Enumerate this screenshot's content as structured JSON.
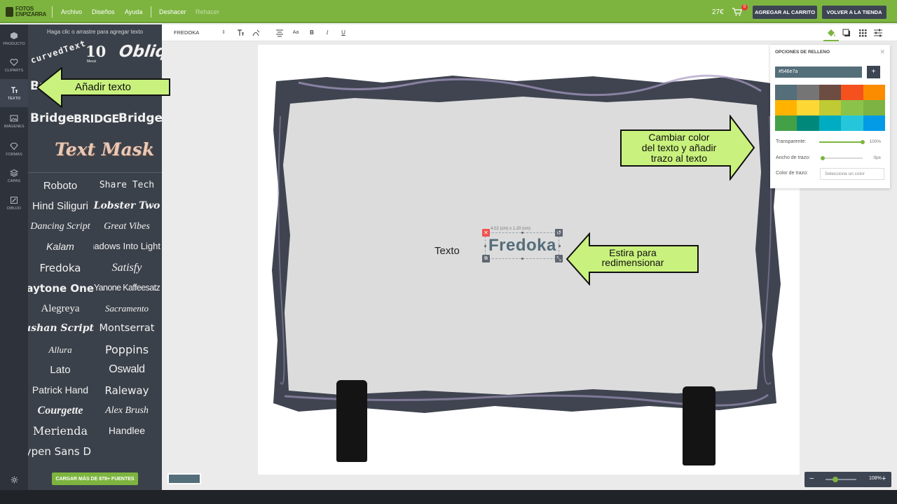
{
  "app": {
    "logo_line1": "FOTOS",
    "logo_line2": "ENPIZARRA"
  },
  "top_menu": {
    "archivo": "Archivo",
    "disenos": "Diseños",
    "ayuda": "Ayuda",
    "deshacer": "Deshacer",
    "rehacer": "Rehacer"
  },
  "header": {
    "price": "27€",
    "cart_count": "0",
    "add_to_cart": "AGREGAR AL CARRITO",
    "back_to_store": "VOLVER A LA TIENDA"
  },
  "rail": {
    "items": [
      {
        "label": "PRODUCTO",
        "icon": "cube-icon"
      },
      {
        "label": "CLIPARTS",
        "icon": "heart-icon"
      },
      {
        "label": "TEXTO",
        "icon": "text-icon"
      },
      {
        "label": "IMÁGENES",
        "icon": "image-icon"
      },
      {
        "label": "FORMAS",
        "icon": "diamond-icon"
      },
      {
        "label": "CAPAS",
        "icon": "layers-icon"
      },
      {
        "label": "DIBUJO",
        "icon": "pencil-icon"
      }
    ],
    "active_index": 2
  },
  "text_panel": {
    "hint": "Haga clic o arrastre para agregar texto",
    "effects": {
      "curved": "curvedText",
      "ten": "10",
      "ten_sub": "Messi",
      "oblique": "Oblique",
      "bridge1": "Bridge",
      "bridge2": "BRIDGE",
      "bridge3": "Bridge",
      "textmask": "Text Mask"
    },
    "fonts": [
      "Roboto",
      "Share Tech",
      "Hind Siliguri",
      "Lobster Two",
      "Dancing Script",
      "Great Vibes",
      "Kalam",
      "Shadows Into Light",
      "Fredoka",
      "Satisfy",
      "Paytone One",
      "Yanone Kaffeesatz",
      "Alegreya",
      "Sacramento",
      "Kaushan Script",
      "Montserrat",
      "Allura",
      "Poppins",
      "Lato",
      "Oswald",
      "Patrick Hand",
      "Raleway",
      "Courgette",
      "Alex Brush",
      "Merienda",
      "Handlee",
      "Hypen Sans D"
    ],
    "load_more": "CARGAR MÁS DE 878+ FUENTES"
  },
  "toolbar": {
    "font_name": "FREDOKA",
    "icons": [
      "text-size-icon",
      "text-curve-icon",
      "align-center-icon",
      "case-icon",
      "bold-icon",
      "italic-icon",
      "underline-icon"
    ],
    "bold": "B",
    "italic": "I",
    "underline": "U",
    "case": "Aa",
    "right_icons": [
      "fill-bucket-icon",
      "shadow-icon",
      "pattern-icon",
      "settings-sliders-icon"
    ]
  },
  "canvas": {
    "texto": "Texto",
    "selected_text": "Fredoka",
    "dimensions": "4.02 (cm) x 1.20 (cm)"
  },
  "callouts": {
    "add_text": "Añadir texto",
    "color_line1": "Cambiar color",
    "color_line2": "del texto y añadir",
    "color_line3": "trazo al texto",
    "resize_line1": "Estira para",
    "resize_line2": "redimensionar"
  },
  "fill_panel": {
    "title": "OPCIONES DE RELLENO",
    "hex": "#546e7a",
    "swatches": [
      "#546e7a",
      "#757575",
      "#6d4c41",
      "#f4511e",
      "#fb8c00",
      "#ffb300",
      "#fdd835",
      "#c0ca33",
      "#8bc34a",
      "#7cb342",
      "#43a047",
      "#00897b",
      "#00acc1",
      "#26c6da",
      "#039be5"
    ],
    "transparency_label": "Transparente:",
    "transparency_value": "100%",
    "stroke_width_label": "Ancho de trazo:",
    "stroke_width_value": "0px",
    "stroke_color_label": "Color de trazo:",
    "stroke_color_placeholder": "Selecciona un color"
  },
  "zoom": {
    "value": "108%",
    "minus": "−",
    "plus": "+"
  },
  "colors": {
    "accent": "#7db440",
    "dark_button": "#3d4553",
    "text_color": "#546e7a"
  }
}
